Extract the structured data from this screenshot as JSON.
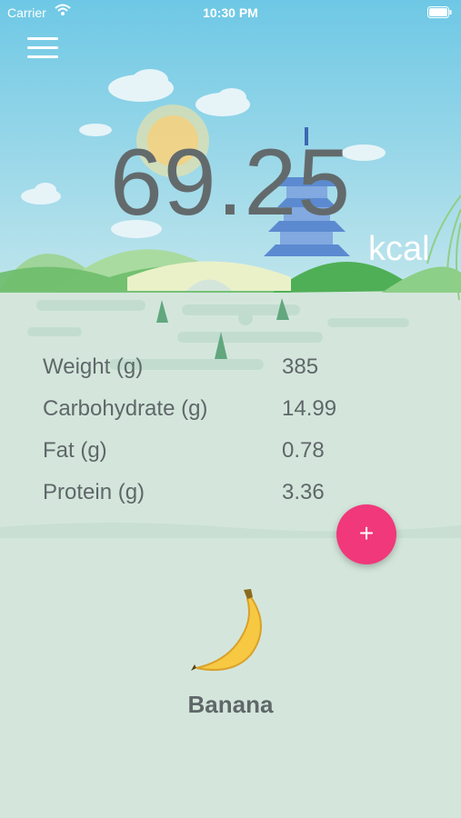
{
  "status_bar": {
    "carrier": "Carrier",
    "time": "10:30 PM"
  },
  "summary": {
    "calories": "69.25",
    "unit": "kcal"
  },
  "nutrients": [
    {
      "label": "Weight (g)",
      "value": "385"
    },
    {
      "label": "Carbohydrate (g)",
      "value": "14.99"
    },
    {
      "label": "Fat (g)",
      "value": "0.78"
    },
    {
      "label": "Protein (g)",
      "value": "3.36"
    }
  ],
  "fab": {
    "symbol": "+"
  },
  "food": {
    "name": "Banana",
    "icon": "banana-icon"
  },
  "colors": {
    "accent": "#f0387a",
    "sky": "#7ccbe6",
    "ground": "#d4e6dc"
  }
}
